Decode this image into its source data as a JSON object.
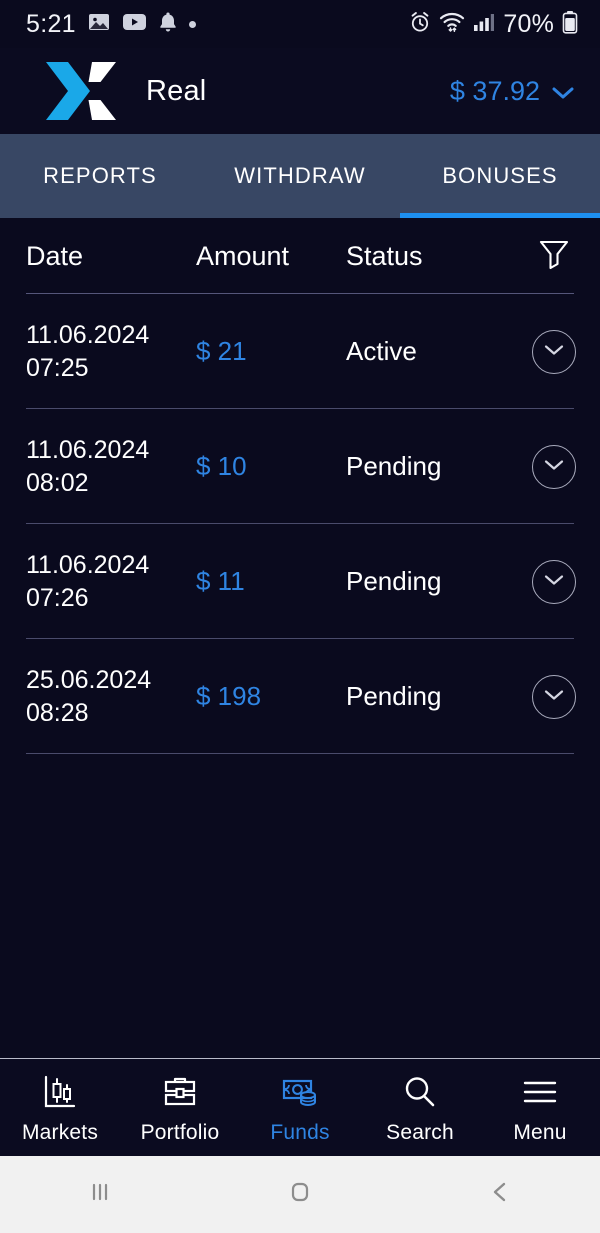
{
  "status_bar": {
    "time": "5:21",
    "battery_percent": "70%",
    "left_icons": [
      "gallery-icon",
      "youtube-icon",
      "bell-icon",
      "dot-indicator"
    ],
    "right_icons": [
      "alarm-icon",
      "wifi-icon",
      "signal-icon",
      "battery-icon"
    ]
  },
  "header": {
    "logo": "x-logo",
    "account_name": "Real",
    "balance": "$ 37.92",
    "balance_chevron": "chevron-down-icon"
  },
  "tabs": [
    {
      "label": "REPORTS",
      "active": false
    },
    {
      "label": "WITHDRAW",
      "active": false
    },
    {
      "label": "BONUSES",
      "active": true
    }
  ],
  "table": {
    "columns": [
      "Date",
      "Amount",
      "Status"
    ],
    "filter_icon": "filter-funnel-icon",
    "rows": [
      {
        "date": "11.06.2024",
        "time": "07:25",
        "amount": "$ 21",
        "status": "Active",
        "expand_icon": "chevron-down-icon"
      },
      {
        "date": "11.06.2024",
        "time": "08:02",
        "amount": "$ 10",
        "status": "Pending",
        "expand_icon": "chevron-down-icon"
      },
      {
        "date": "11.06.2024",
        "time": "07:26",
        "amount": "$ 11",
        "status": "Pending",
        "expand_icon": "chevron-down-icon"
      },
      {
        "date": "25.06.2024",
        "time": "08:28",
        "amount": "$ 198",
        "status": "Pending",
        "expand_icon": "chevron-down-icon"
      }
    ]
  },
  "bottom_nav": [
    {
      "label": "Markets",
      "icon": "candlestick-chart-icon",
      "active": false
    },
    {
      "label": "Portfolio",
      "icon": "briefcase-icon",
      "active": false
    },
    {
      "label": "Funds",
      "icon": "banknote-coins-icon",
      "active": true
    },
    {
      "label": "Search",
      "icon": "magnifier-icon",
      "active": false
    },
    {
      "label": "Menu",
      "icon": "hamburger-menu-icon",
      "active": false
    }
  ],
  "android_nav": [
    {
      "icon": "recents-icon"
    },
    {
      "icon": "home-icon"
    },
    {
      "icon": "back-icon"
    }
  ],
  "colors": {
    "background": "#0a0a1e",
    "tabbar": "#384764",
    "accent": "#2f84e2",
    "tab_underline": "#1e90f0",
    "logo_cyan": "#1aa8e8",
    "text": "#ffffff"
  }
}
